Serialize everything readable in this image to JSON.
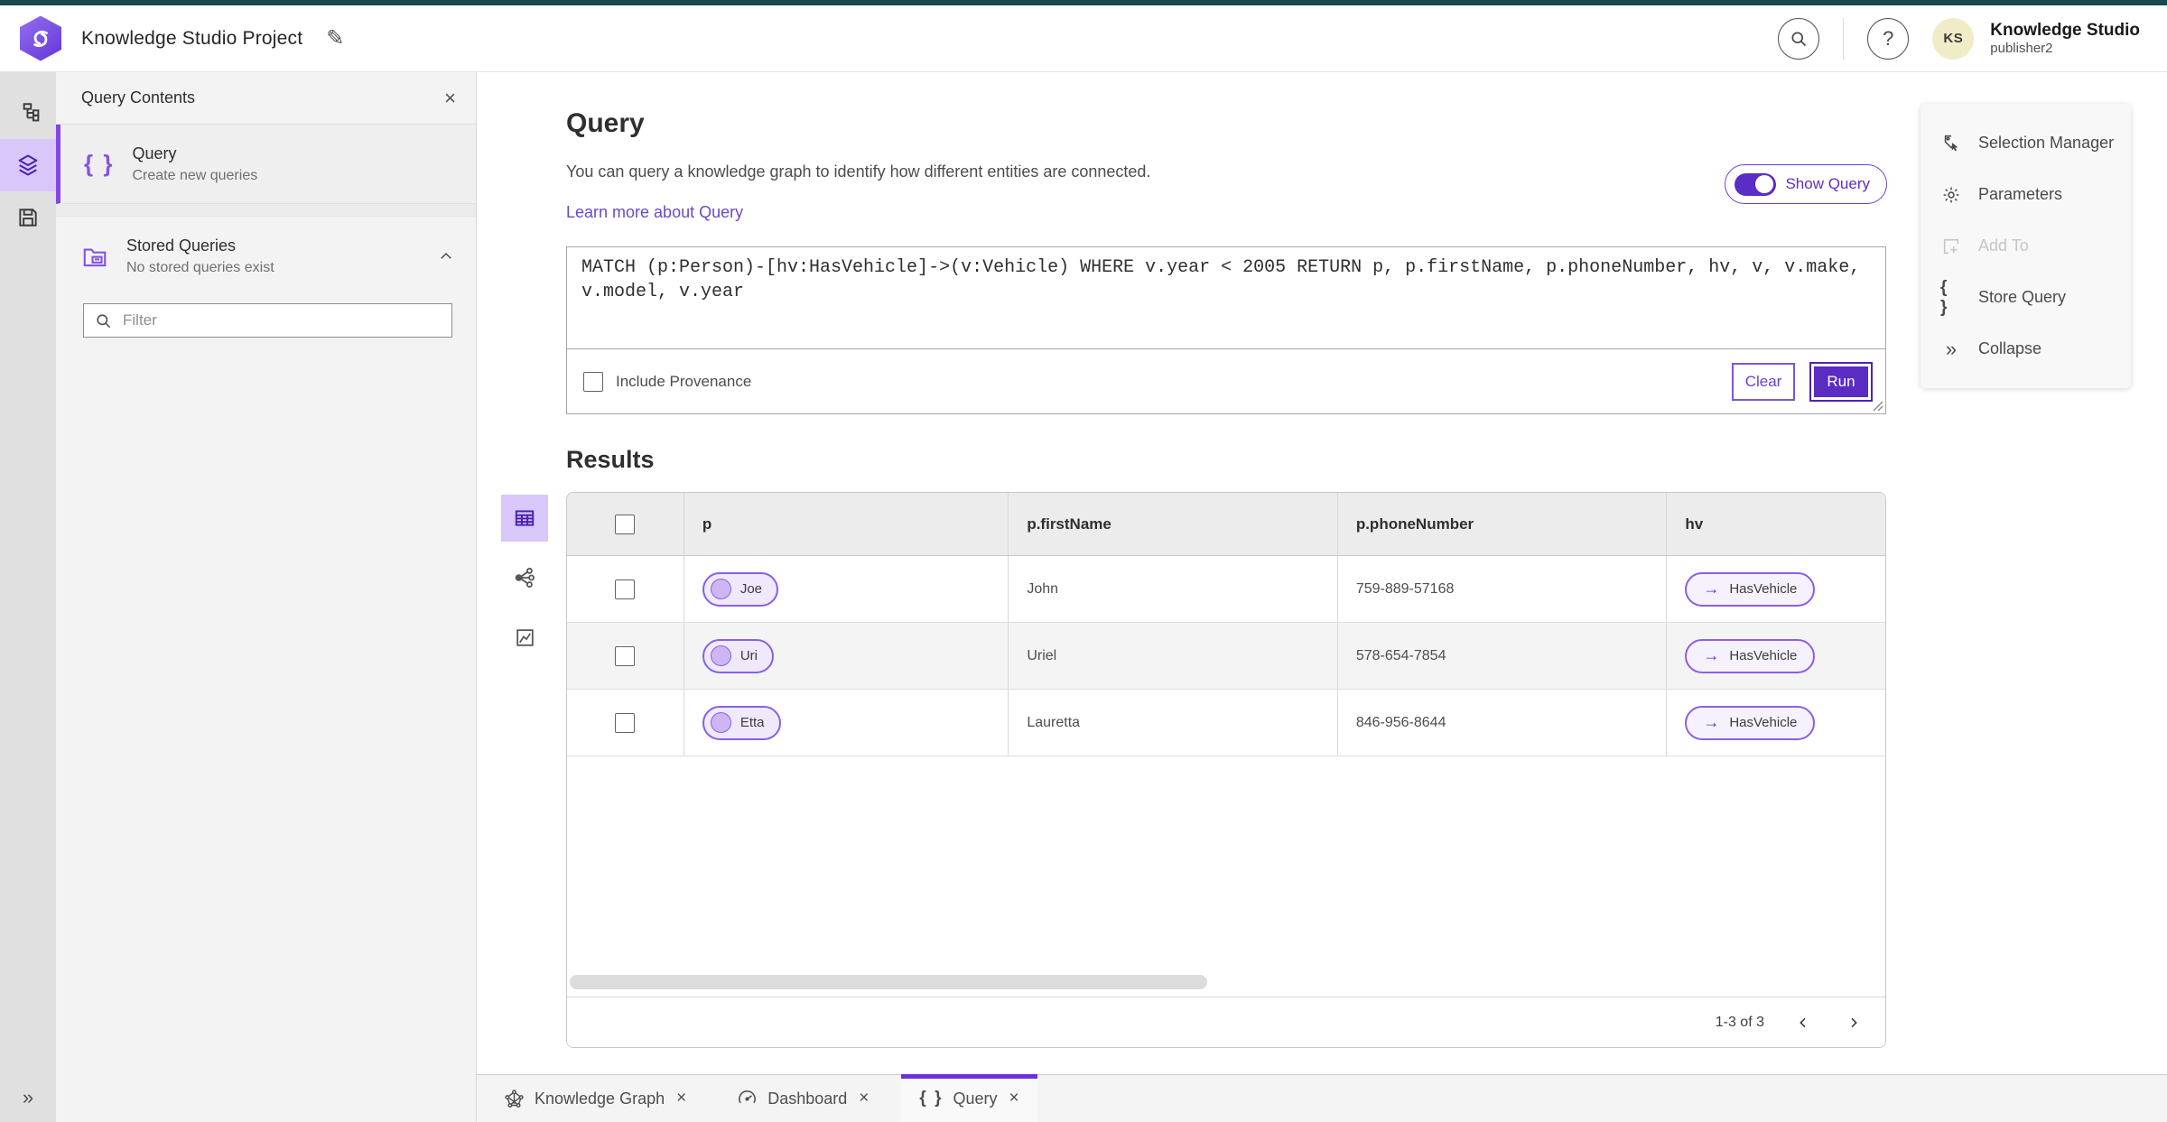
{
  "colors": {
    "accent_purple": "#5b2cc4",
    "teal_strip": "#17494f",
    "selected_rail": "#d9c7fa"
  },
  "header": {
    "title": "Knowledge Studio Project",
    "user": {
      "initials": "KS",
      "name": "Knowledge Studio",
      "role": "publisher2"
    }
  },
  "contents_panel": {
    "title": "Query Contents",
    "query_item": {
      "title": "Query",
      "subtitle": "Create new queries"
    },
    "stored_queries": {
      "title": "Stored Queries",
      "subtitle": "No stored queries exist"
    },
    "filter_placeholder": "Filter"
  },
  "query_section": {
    "title": "Query",
    "description": "You can query a knowledge graph to identify how different entities are connected.",
    "learn_more_link": "Learn more about Query",
    "show_query_label": "Show Query",
    "query_text": "MATCH (p:Person)-[hv:HasVehicle]->(v:Vehicle) WHERE v.year < 2005 RETURN p, p.firstName, p.phoneNumber, hv, v, v.make, v.model, v.year",
    "include_provenance_label": "Include Provenance",
    "clear_button": "Clear",
    "run_button": "Run"
  },
  "results": {
    "title": "Results",
    "columns": [
      "p",
      "p.firstName",
      "p.phoneNumber",
      "hv"
    ],
    "rows": [
      {
        "p": "Joe",
        "firstName": "John",
        "phone": "759-889-57168",
        "hv": "HasVehicle",
        "arrow": "→"
      },
      {
        "p": "Uri",
        "firstName": "Uriel",
        "phone": "578-654-7854",
        "hv": "HasVehicle",
        "arrow": "→"
      },
      {
        "p": "Etta",
        "firstName": "Lauretta",
        "phone": "846-956-8644",
        "hv": "HasVehicle",
        "arrow": "→"
      }
    ],
    "pagination": "1-3 of 3"
  },
  "right_panel": {
    "items": [
      {
        "label": "Selection Manager"
      },
      {
        "label": "Parameters"
      },
      {
        "label": "Add To",
        "disabled": true
      },
      {
        "label": "Store Query"
      },
      {
        "label": "Collapse"
      }
    ]
  },
  "tab_bar": {
    "tabs": [
      {
        "label": "Knowledge Graph"
      },
      {
        "label": "Dashboard"
      },
      {
        "label": "Query",
        "active": true
      }
    ]
  },
  "glyphs": {
    "braces": "{ }",
    "collapse": "»",
    "expand": "»",
    "edit": "✎",
    "close": "×",
    "help": "?"
  }
}
